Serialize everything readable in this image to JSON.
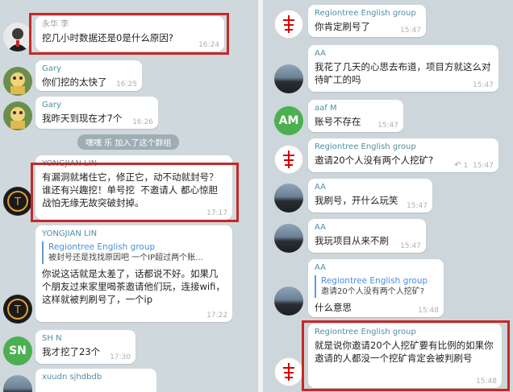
{
  "left": {
    "messages": [
      {
        "sender": "永华 李",
        "text": "挖几小时数据还是0是什么原因?",
        "time": "16:24"
      },
      {
        "sender": "Gary",
        "text": "你们挖的太快了",
        "time": "16:25"
      },
      {
        "sender": "Gary",
        "text": "我昨天到现在才7个",
        "time": "16:26"
      },
      {
        "sender": "YONGJIAN LIN",
        "text": "有漏洞就堵住它，修正它，动不动就封号？谁还有兴趣挖！单号挖  不邀请人 都心惊胆战怕无缘无故突破封掉。",
        "time": "17:17"
      },
      {
        "sender": "YONGJIAN LIN",
        "quote_name": "Regiontree English group",
        "quote_text": "被封号还是找找原因吧 一个IP超过两个账...",
        "text": "你说这话就是太差了，话都说不好。如果几个朋友过来家里喝茶邀请他们玩，连接wifi，这样就被判刷号了，一个ip",
        "time": "17:22"
      },
      {
        "sender": "SH N",
        "avatar_text": "SN",
        "text": "我才挖了23个",
        "time": "17:30"
      },
      {
        "sender": "xuudn sjhdbdb",
        "text": "",
        "time": ""
      }
    ],
    "system_notice": "嘿嘿 乐 加入了这个群组"
  },
  "right": {
    "messages": [
      {
        "sender": "Regiontree English group",
        "text": "你肯定刷号了",
        "time": "15:47"
      },
      {
        "sender": "AA",
        "text": "我花了几天的心思去布道，项目方就这么对待旷工的吗",
        "time": "15:47"
      },
      {
        "sender": "aaf M",
        "avatar_text": "AM",
        "text": "账号不存在",
        "time": "15:47"
      },
      {
        "sender": "Regiontree English group",
        "text": "邀请20个人没有两个人挖矿?",
        "time": "15:47",
        "reply_count": "1"
      },
      {
        "sender": "AA",
        "text": "我刷号，开什么玩笑",
        "time": "15:47"
      },
      {
        "sender": "AA",
        "text": "我玩项目从来不刷",
        "time": "15:47"
      },
      {
        "sender": "AA",
        "quote_name": "Regiontree English group",
        "quote_text": "邀请20个人没有两个人挖矿?",
        "text": "什么意思",
        "time": "15:48"
      },
      {
        "sender": "Regiontree English group",
        "text": "就是说你邀请20个人挖矿要有比例的如果你邀请的人都没一个挖矿肯定会被判刷号",
        "time": "15:48"
      }
    ]
  },
  "colors": {
    "highlight": "#c62828",
    "link": "#4a90d9",
    "sender_teal": "#4e8fa3",
    "avatar_green": "#4caf50"
  }
}
